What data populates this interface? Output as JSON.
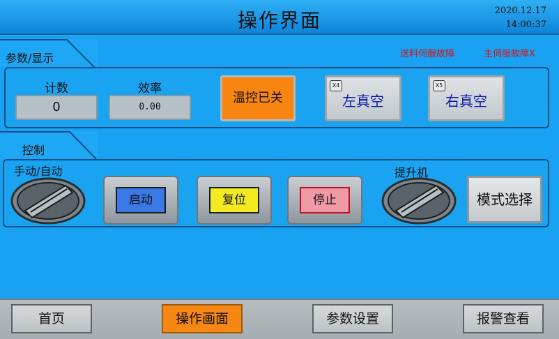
{
  "header": {
    "title": "操作界面",
    "date": "2020.12.17",
    "time": "14:00:37"
  },
  "params_section": {
    "tab_label": "参数/显示",
    "faults": [
      "送料伺服故障",
      "主伺服故障X"
    ],
    "count_label": "计数",
    "count_value": "0",
    "efficiency_label": "效率",
    "efficiency_value": "0.00",
    "temp_control_label": "温控已关",
    "left_vacuum": {
      "tag": "X4",
      "label": "左真空"
    },
    "right_vacuum": {
      "tag": "X5",
      "label": "右真空"
    }
  },
  "control_section": {
    "tab_label": "控制",
    "manual_auto_label": "手动/自动",
    "start_label": "启动",
    "reset_label": "复位",
    "stop_label": "停止",
    "hoist_label": "提升机",
    "mode_select_label": "模式选择"
  },
  "footer": {
    "items": [
      {
        "label": "首页",
        "active": false
      },
      {
        "label": "操作画面",
        "active": true
      },
      {
        "label": "参数设置",
        "active": false
      },
      {
        "label": "报警查看",
        "active": false
      }
    ]
  },
  "colors": {
    "background": "#1aa3f0",
    "active_nav": "#f58712",
    "fault_text": "#d8101a",
    "temp_button": "#f78510",
    "start_face": "#3a78e6",
    "reset_face": "#f3ea22",
    "stop_face": "#ef9aa5"
  }
}
